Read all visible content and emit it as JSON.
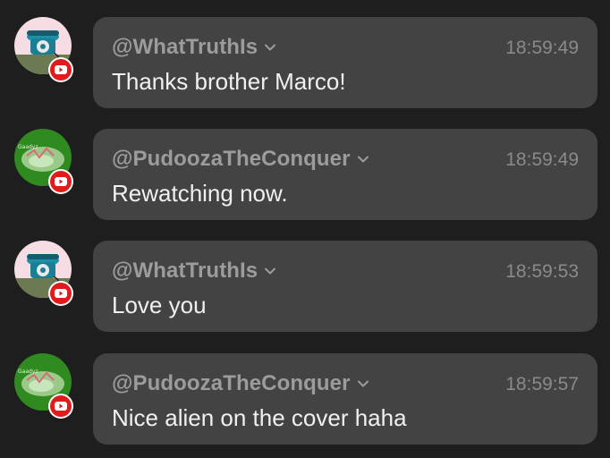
{
  "messages": [
    {
      "author": "@WhatTruthIs",
      "time": "18:59:49",
      "text": "Thanks brother Marco!",
      "avatar": "telephone-avatar",
      "platform": "youtube"
    },
    {
      "author": "@PudoozaTheConquer",
      "time": "18:59:49",
      "text": "Rewatching now.",
      "avatar": "green-creature-avatar",
      "platform": "youtube"
    },
    {
      "author": "@WhatTruthIs",
      "time": "18:59:53",
      "text": "Love you",
      "avatar": "telephone-avatar",
      "platform": "youtube"
    },
    {
      "author": "@PudoozaTheConquer",
      "time": "18:59:57",
      "text": "Nice alien on the cover haha",
      "avatar": "green-creature-avatar",
      "platform": "youtube"
    }
  ],
  "colors": {
    "background": "#1e1e1e",
    "bubble": "#434343",
    "author": "#9c9c9c",
    "time": "#8a8a8a",
    "text": "#f0f0f0",
    "youtube_red": "#e01b1b"
  }
}
